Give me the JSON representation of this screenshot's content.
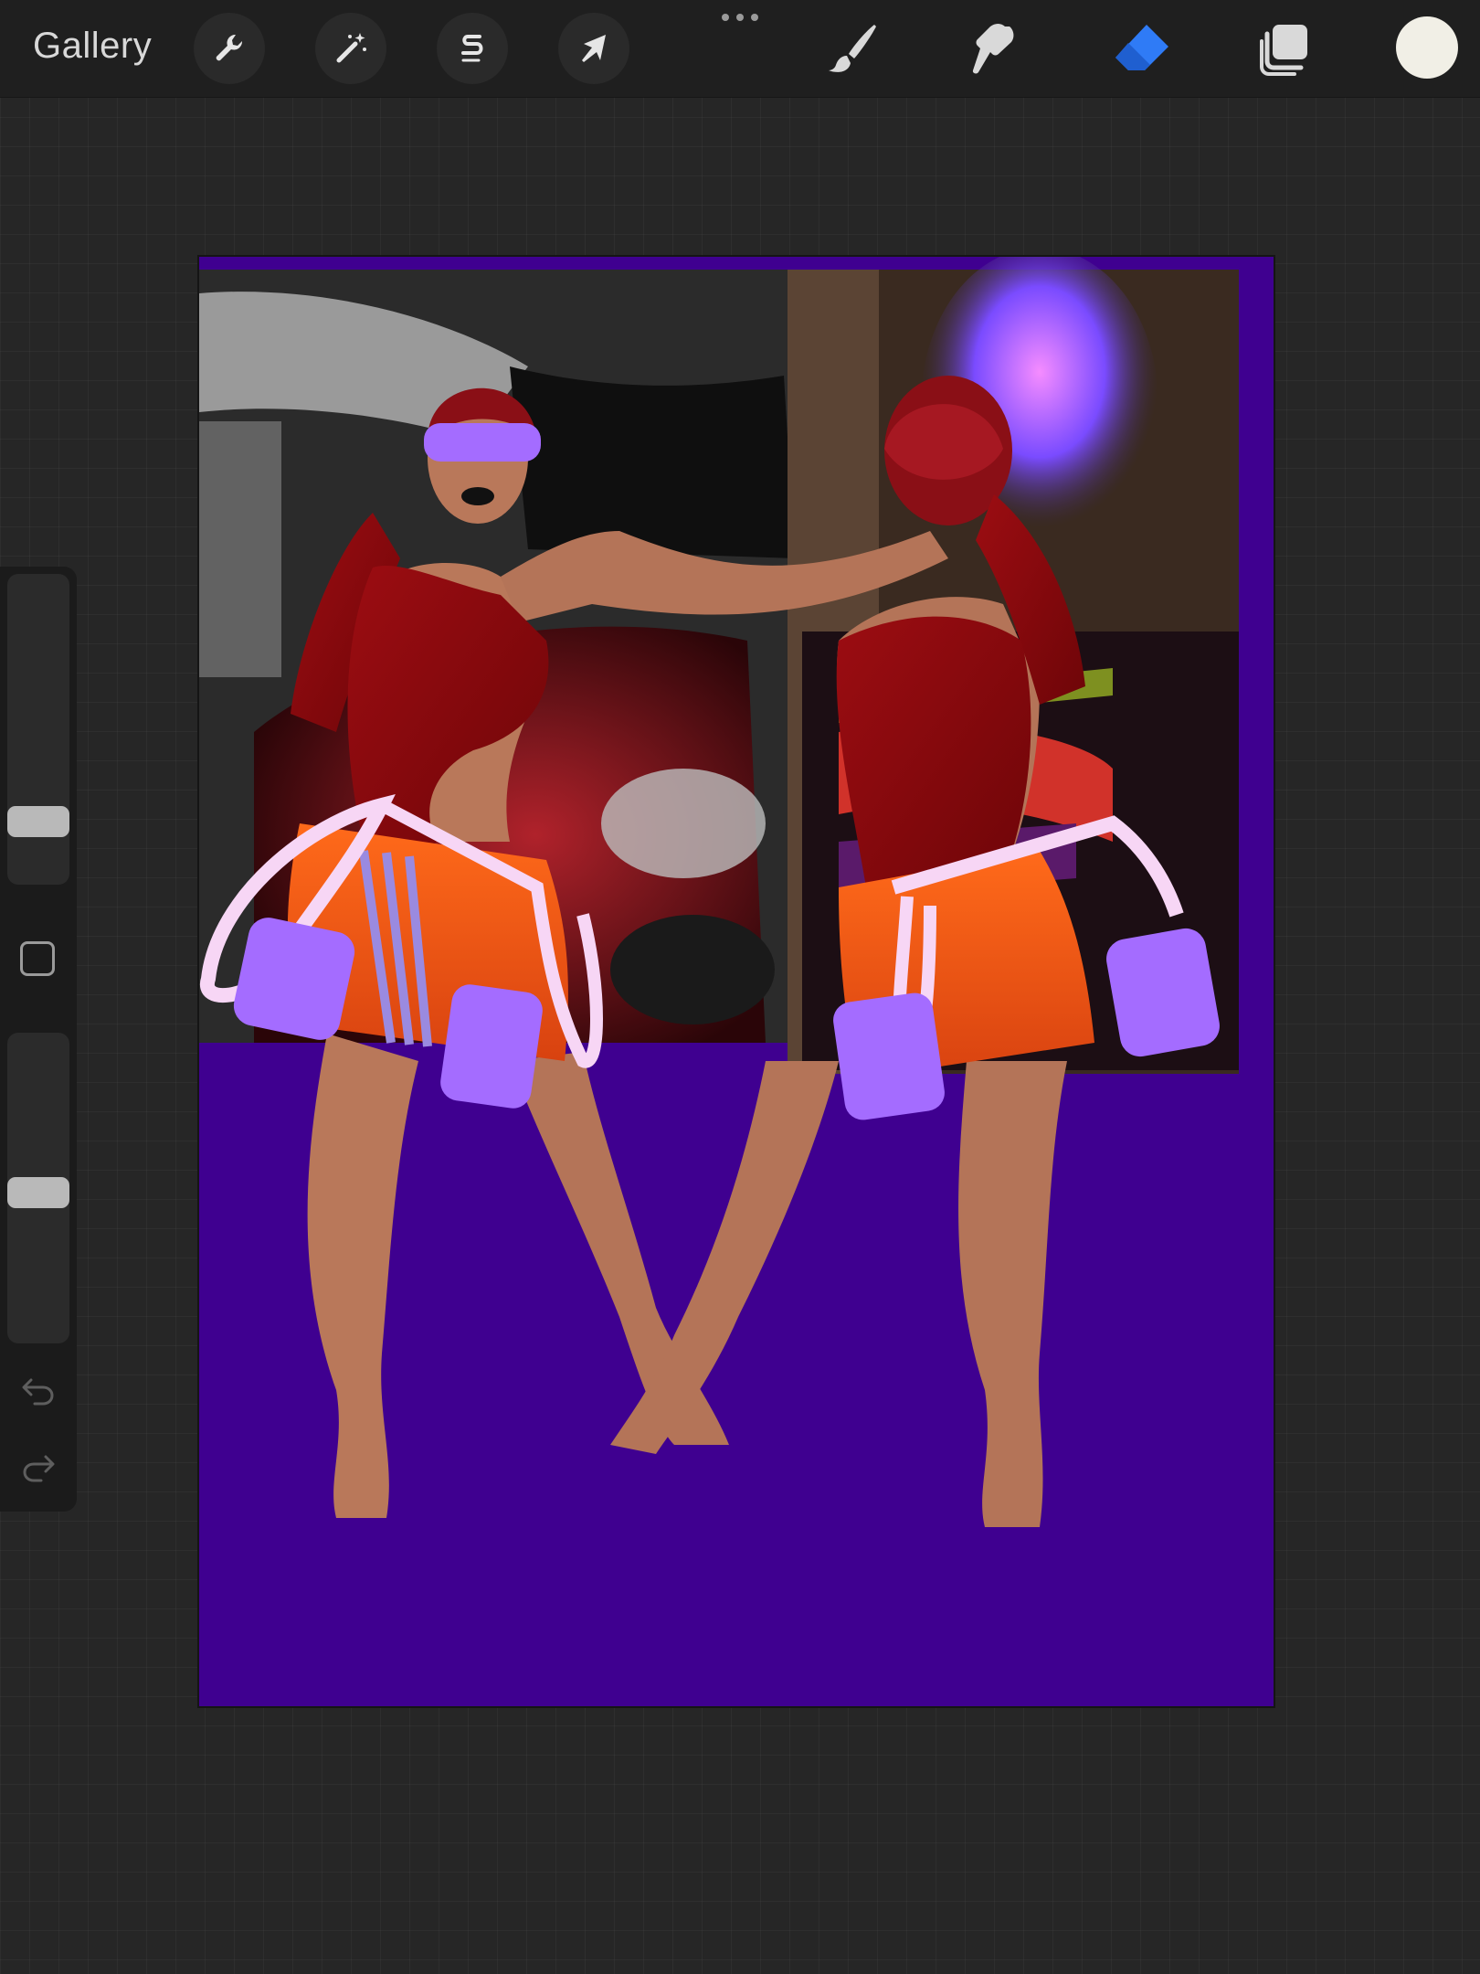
{
  "toolbar": {
    "gallery_label": "Gallery",
    "left_tools": [
      {
        "name": "actions",
        "icon": "wrench-icon"
      },
      {
        "name": "adjustments",
        "icon": "magic-wand-icon"
      },
      {
        "name": "selection",
        "icon": "selection-s-icon"
      },
      {
        "name": "transform",
        "icon": "arrow-cursor-icon"
      }
    ],
    "more_menu_icon": "ellipsis-icon",
    "right_tools": [
      {
        "name": "brush",
        "icon": "brush-icon",
        "active": false
      },
      {
        "name": "smudge",
        "icon": "smudge-icon",
        "active": false
      },
      {
        "name": "eraser",
        "icon": "eraser-icon",
        "active": true
      },
      {
        "name": "layers",
        "icon": "layers-icon",
        "active": false
      }
    ],
    "active_color": "#f1efe6",
    "active_tool_color": "#2f7bf6"
  },
  "sidebar": {
    "brush_size_level": 0.78,
    "brush_opacity_level": 0.48,
    "modifier_icon": "square-icon",
    "undo_icon": "undo-icon",
    "redo_icon": "redo-icon"
  },
  "canvas": {
    "background_color": "#3f0090",
    "description_icon": "artwork-image"
  }
}
